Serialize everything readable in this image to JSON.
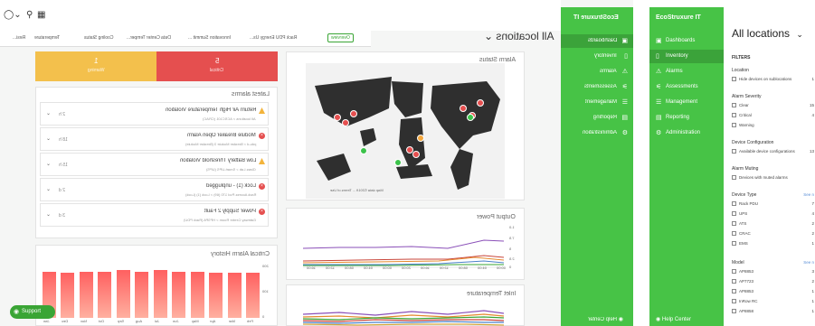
{
  "mirror": {
    "location_title": "All locations",
    "tabs": [
      "Overview",
      "Rack PDU Energy Us...",
      "Innovation Summit ...",
      "Data Center Temper...",
      "Cooling Status",
      "Temperature",
      "Resi..."
    ],
    "summary": {
      "critical_count": "5",
      "critical_label": "Critical",
      "warning_count": "1",
      "warning_label": "Warning"
    },
    "latest_alarms_title": "Latest alarms",
    "alarms": [
      {
        "title": "Return Air High Temperature Violation",
        "sub": "All locations > ACSC101 (CRAC)",
        "age": "2 h",
        "severity": "warning"
      },
      {
        "title": "Module Breaker Open Alarm",
        "sub": "pdu-d > Breaker Module 3 (Breaker Module)",
        "age": "18 h",
        "severity": "critical"
      },
      {
        "title": "Low Battery Threshold Violation",
        "sub": "Glass Lab > Smart-UPS (UPS)",
        "age": "15 h",
        "severity": "warning"
      },
      {
        "title": "Lock (1) - unplugged",
        "sub": "Rack Access Pod 170 (69) > Lock (1) (Lock)",
        "age": "2 d",
        "severity": "critical"
      },
      {
        "title": "Power Supply 2 Fault",
        "sub": "Gateway Centre Room > HP3PA (Rack PDU)",
        "age": "3 d",
        "severity": "critical"
      }
    ],
    "alarm_status_title": "Alarm Status",
    "map_attribution": "Map data ©2019 ... Terms of Use",
    "critical_history_title": "Critical Alarm History",
    "history": {
      "y_ticks": [
        "200",
        "100",
        "0"
      ],
      "months": [
        "Feb",
        "Mar",
        "Apr",
        "May",
        "Jun",
        "Jul",
        "Aug",
        "Sep",
        "Oct",
        "Nov",
        "Dec",
        "Jan"
      ],
      "values": [
        160,
        160,
        160,
        165,
        165,
        170,
        165,
        170,
        165,
        165,
        160,
        165
      ]
    },
    "output_power_title": "Output Power",
    "output_power_ticks": [
      "1.0",
      "7.5",
      "5",
      "2.5",
      "0"
    ],
    "output_power_times": [
      "00:00",
      "04:00",
      "08:00",
      "12:00",
      "16:00",
      "20:00",
      "00:00",
      "04:00",
      "08:00",
      "12:00",
      "16:00"
    ],
    "inlet_temperature_title": "Inlet Temperature",
    "support_label": "Support"
  },
  "nav_left": {
    "logo": "EcoStruxure IT",
    "items": [
      {
        "label": "Dashboards",
        "icon": "dashboard-icon",
        "active": true
      },
      {
        "label": "Inventory",
        "icon": "inventory-icon",
        "active": false
      },
      {
        "label": "Alarms",
        "icon": "alarm-icon",
        "active": false
      },
      {
        "label": "Assessments",
        "icon": "assessment-icon",
        "active": false
      },
      {
        "label": "Management",
        "icon": "management-icon",
        "active": false
      },
      {
        "label": "Reporting",
        "icon": "reporting-icon",
        "active": false
      },
      {
        "label": "Administration",
        "icon": "administration-icon",
        "active": false
      }
    ],
    "help": "Help Center"
  },
  "nav_right": {
    "logo": "EcoStruxure IT",
    "items": [
      {
        "label": "Dashboards",
        "active": false
      },
      {
        "label": "Inventory",
        "active": true
      },
      {
        "label": "Alarms",
        "active": false
      },
      {
        "label": "Assessments",
        "active": false
      },
      {
        "label": "Management",
        "active": false
      },
      {
        "label": "Reporting",
        "active": false
      },
      {
        "label": "Administration",
        "active": false
      }
    ],
    "help": "Help Center"
  },
  "filters": {
    "title": "All locations",
    "filters_label": "FILTERS",
    "location_label": "Location",
    "location_option": "Hide devices on sublocations",
    "location_count": "1",
    "alarm_severity_label": "Alarm Severity",
    "severity": [
      {
        "label": "Clear",
        "count": "15"
      },
      {
        "label": "Critical",
        "count": "4"
      },
      {
        "label": "Warning",
        "count": ""
      }
    ],
    "device_config_label": "Device Configuration",
    "device_config_option": "Available device configurations",
    "device_config_count": "13",
    "alarm_muting_label": "Alarm Muting",
    "alarm_muting_option": "Devices with muted alarms",
    "device_type_label": "Device Type",
    "see_more": "See n",
    "device_types": [
      {
        "label": "Rack PDU",
        "count": "7"
      },
      {
        "label": "UPS",
        "count": "4"
      },
      {
        "label": "ATS",
        "count": "2"
      },
      {
        "label": "CRAC",
        "count": "2"
      },
      {
        "label": "EMS",
        "count": "1"
      }
    ],
    "model_label": "Model",
    "models": [
      {
        "label": "AP8853",
        "count": "3"
      },
      {
        "label": "AP7723",
        "count": "2"
      },
      {
        "label": "AP8853",
        "count": "1"
      },
      {
        "label": "InRow RC",
        "count": "1"
      },
      {
        "label": "AP8858",
        "count": "1"
      }
    ]
  },
  "colors": {
    "brand_green": "#47c346",
    "critical": "#e54f4f",
    "warning": "#f3c04c"
  }
}
